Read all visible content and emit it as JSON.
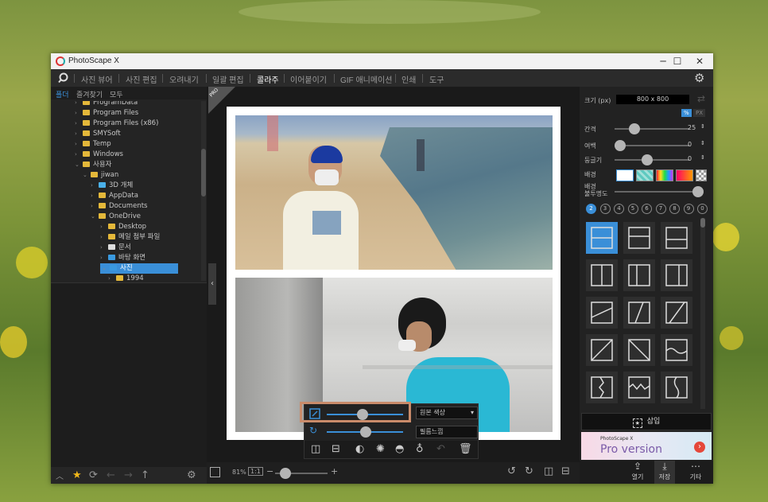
{
  "window": {
    "title": "PhotoScape X"
  },
  "window_controls": {
    "minimize": "─",
    "maximize": "☐",
    "close": "✕"
  },
  "menu": [
    "사진 뷰어",
    "사진 편집",
    "오려내기",
    "일괄 편집",
    "콜라주",
    "이어붙이기",
    "GIF 애니메이션",
    "인쇄",
    "도구"
  ],
  "menu_active": "콜라주",
  "left_tabs": [
    "폴더",
    "즐겨찾기",
    "모두"
  ],
  "tree": [
    {
      "label": "ProgramData",
      "arrow": "›"
    },
    {
      "label": "Program Files",
      "arrow": "›"
    },
    {
      "label": "Program Files (x86)",
      "arrow": "›"
    },
    {
      "label": "SMYSoft",
      "arrow": "›"
    },
    {
      "label": "Temp",
      "arrow": "›"
    },
    {
      "label": "Windows",
      "arrow": "›"
    },
    {
      "label": "사용자",
      "arrow": "⌄"
    },
    {
      "label": "jiwan",
      "arrow": "⌄"
    },
    {
      "label": "3D 개체",
      "arrow": "›"
    },
    {
      "label": "AppData",
      "arrow": "›"
    },
    {
      "label": "Documents",
      "arrow": "›"
    },
    {
      "label": "OneDrive",
      "arrow": "⌄"
    },
    {
      "label": "Desktop",
      "arrow": "›"
    },
    {
      "label": "메일 첨부 파일",
      "arrow": "›"
    },
    {
      "label": "문서",
      "arrow": "›"
    },
    {
      "label": "바탕 화면",
      "arrow": "›"
    },
    {
      "label": "사진",
      "arrow": "⌄",
      "selected": true
    },
    {
      "label": "1994",
      "arrow": "›"
    }
  ],
  "pro_badge": "PRO",
  "popup": {
    "color_label": "원본 색상",
    "filter_label": "필름느낌",
    "dropdown_arrow": "▾"
  },
  "zoom": {
    "value": "81%",
    "ratio_label": "1:1",
    "minus": "−",
    "plus": "+"
  },
  "right": {
    "size_label": "크기 (px)",
    "size_value": "800 x 800",
    "unit_percent": "%",
    "unit_px": "PX",
    "spacing_label": "간격",
    "spacing_value": "25",
    "margin_label": "여백",
    "margin_value": "0",
    "round_label": "둥글기",
    "round_value": "0",
    "bg_label": "배경",
    "bg_opacity_label_1": "배경",
    "bg_opacity_label_2": "불투명도",
    "photo_counts": [
      "2",
      "3",
      "4",
      "5",
      "6",
      "7",
      "8",
      "9",
      "0"
    ],
    "insert_label": "삽입",
    "ad_brand": "PhotoScape X",
    "ad_pro": "Pro",
    "ad_version": " version",
    "open_label": "열기",
    "save_label": "저장",
    "more_label": "기타"
  },
  "colors": {
    "accent": "#3a8fd8",
    "selected_tab": "#ffffff"
  }
}
